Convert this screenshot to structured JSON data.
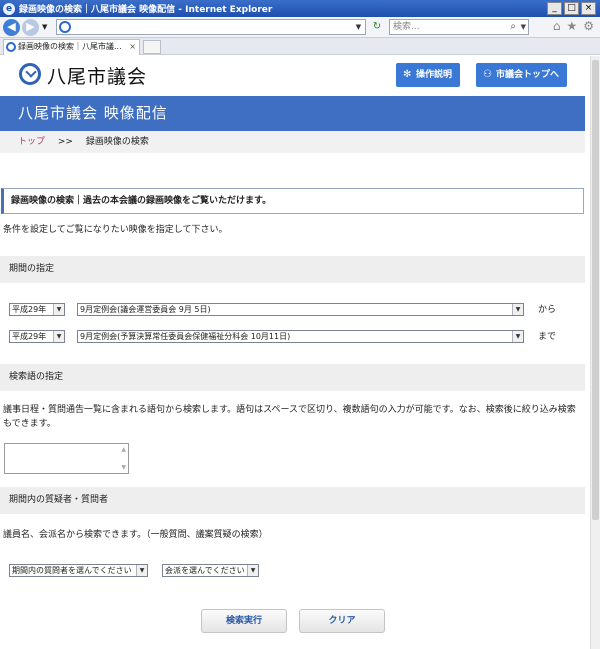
{
  "window": {
    "title": "録画映像の検索｜八尾市議会 映像配信 - Internet Explorer",
    "controls": [
      "_",
      "□",
      "×"
    ]
  },
  "toolbar": {
    "search_placeholder": "検索..."
  },
  "tab": {
    "label": "録画映像の検索｜八尾市議...",
    "close": "×"
  },
  "header": {
    "logo_text": "八尾市議会",
    "manual_button": "操作説明",
    "council_top_button": "市議会トップへ"
  },
  "banner": {
    "title": "八尾市議会  映像配信"
  },
  "breadcrumb": {
    "top": "トップ",
    "separator": ">>",
    "current": "録画映像の検索"
  },
  "intro": {
    "heading": "録画映像の検索｜過去の本会議の録画映像をご覧いただけます。",
    "instruction": "条件を設定してご覧になりたい映像を指定して下さい。"
  },
  "period": {
    "heading": "期間の指定",
    "from_year": "平成29年",
    "from_meeting": "9月定例会(議会運営委員会 9月 5日)",
    "from_suffix": "から",
    "to_year": "平成29年",
    "to_meeting": "9月定例会(予算決算常任委員会保健福祉分科会 10月11日)",
    "to_suffix": "まで"
  },
  "keyword": {
    "heading": "検索語の指定",
    "description": "議事日程・質問通告一覧に含まれる語句から検索します。語句はスペースで区切り、複数語句の入力が可能です。なお、検索後に絞り込み検索もできます。",
    "value": ""
  },
  "questioner": {
    "heading": "期間内の質疑者・質問者",
    "description": "議員名、会派名から検索できます。（一般質問、議案質疑の検索）",
    "member_select": "期間内の質問者を選んでください",
    "faction_select": "会派を選んでください"
  },
  "actions": {
    "search": "検索実行",
    "clear": "クリア"
  }
}
